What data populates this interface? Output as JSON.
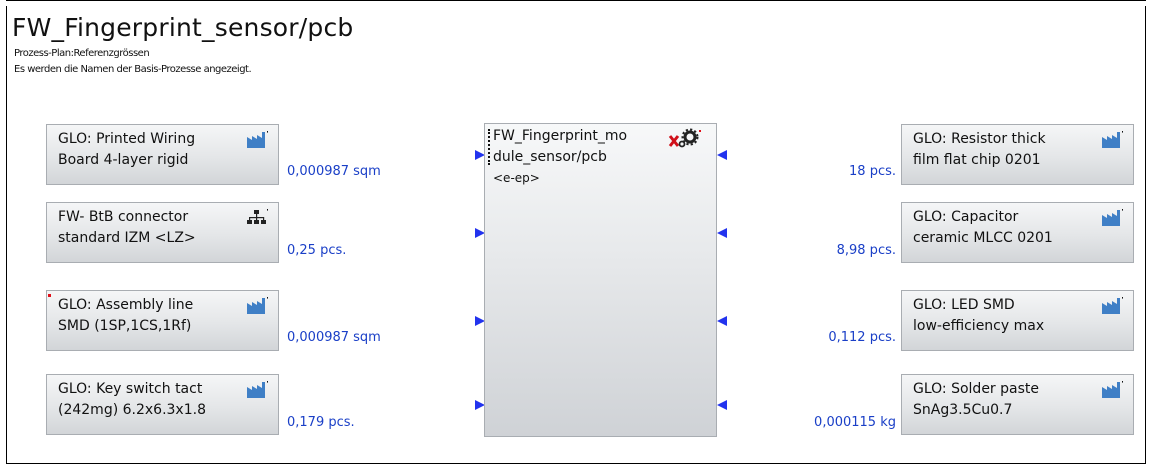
{
  "title": "FW_Fingerprint_sensor/pcb",
  "subtitle_1": "Prozess-Plan:Referenzgrössen",
  "subtitle_2": "Es werden die Namen der Basis-Prozesse angezeigt.",
  "center_process": {
    "name_line1": "FW_Fingerprint_mo",
    "name_line2": "dule_sensor/pcb",
    "tag": "<e-ep>",
    "icons": [
      "x-icon",
      "gear-icon"
    ]
  },
  "inputs_left": [
    {
      "line1": "GLO: Printed Wiring",
      "line2": "Board 4-layer rigid",
      "quantity": "0,000987 sqm",
      "icon": "factory-icon"
    },
    {
      "line1": "FW- BtB connector",
      "line2": "standard IZM <LZ>",
      "quantity": "0,25 pcs.",
      "icon": "hierarchy-icon"
    },
    {
      "line1": "GLO: Assembly line",
      "line2": "SMD (1SP,1CS,1Rf)",
      "quantity": "0,000987 sqm",
      "icon": "factory-icon"
    },
    {
      "line1": "GLO: Key switch tact",
      "line2": "(242mg) 6.2x6.3x1.8",
      "quantity": "0,179 pcs.",
      "icon": "factory-icon"
    }
  ],
  "inputs_right": [
    {
      "line1": "GLO: Resistor thick",
      "line2": "film flat chip 0201",
      "quantity": "18 pcs.",
      "icon": "factory-icon"
    },
    {
      "line1": "GLO: Capacitor",
      "line2": "ceramic MLCC 0201",
      "quantity": "8,98 pcs.",
      "icon": "factory-icon"
    },
    {
      "line1": "GLO: LED SMD",
      "line2": "low-efficiency max",
      "quantity": "0,112 pcs.",
      "icon": "factory-icon"
    },
    {
      "line1": "GLO: Solder paste",
      "line2": "SnAg3.5Cu0.7",
      "quantity": "0,000115 kg",
      "icon": "factory-icon"
    }
  ],
  "colors": {
    "arrow": "#2233ee",
    "quantity_text": "#1a3fc7",
    "factory_icon": "#3f7fc6",
    "marker_red": "#e0101a"
  }
}
